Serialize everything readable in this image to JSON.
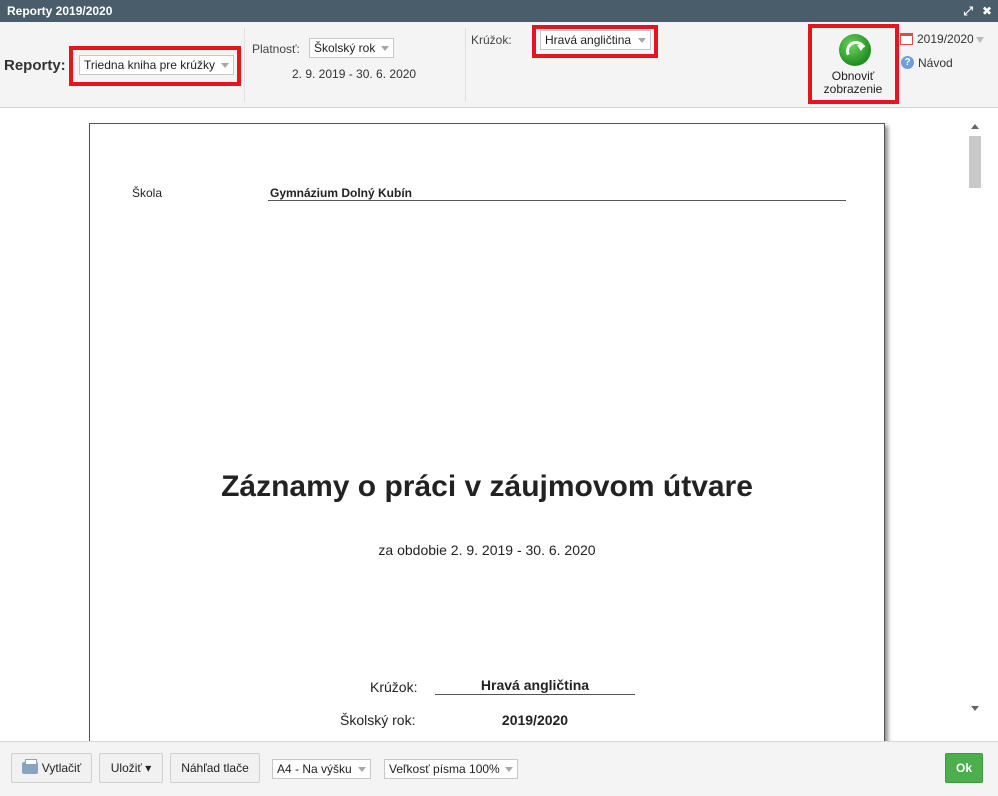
{
  "window": {
    "title": "Reporty 2019/2020"
  },
  "toolbar": {
    "reporty_label": "Reporty:",
    "report_select_value": "Triedna kniha pre krúžky",
    "platnost_label": "Platnosť:",
    "platnost_select_value": "Školský rok",
    "date_range": "2. 9. 2019 - 30. 6. 2020",
    "kruzok_label": "Krúžok:",
    "kruzok_select_value": "Hravá angličtina",
    "refresh_label_line1": "Obnoviť",
    "refresh_label_line2": "zobrazenie",
    "year_value": "2019/2020",
    "help_label": "Návod",
    "highlight_color": "#e3161f"
  },
  "page": {
    "skola_label": "Škola",
    "skola_value": "Gymnázium Dolný Kubín",
    "title": "Záznamy o práci v záujmovom útvare",
    "subtitle": "za obdobie 2. 9. 2019 - 30. 6. 2020",
    "kruzok_label": "Krúžok:",
    "kruzok_value": "Hravá angličtina",
    "rok_label": "Školský rok:",
    "rok_value": "2019/2020"
  },
  "footer": {
    "print_label": "Vytlačiť",
    "save_label": "Uložiť ▾",
    "preview_label": "Náhľad tlače",
    "paper_select_value": "A4 - Na výšku",
    "font_select_value": "Veľkosť písma 100%",
    "ok_label": "Ok",
    "ok_color": "#4cae4c"
  }
}
